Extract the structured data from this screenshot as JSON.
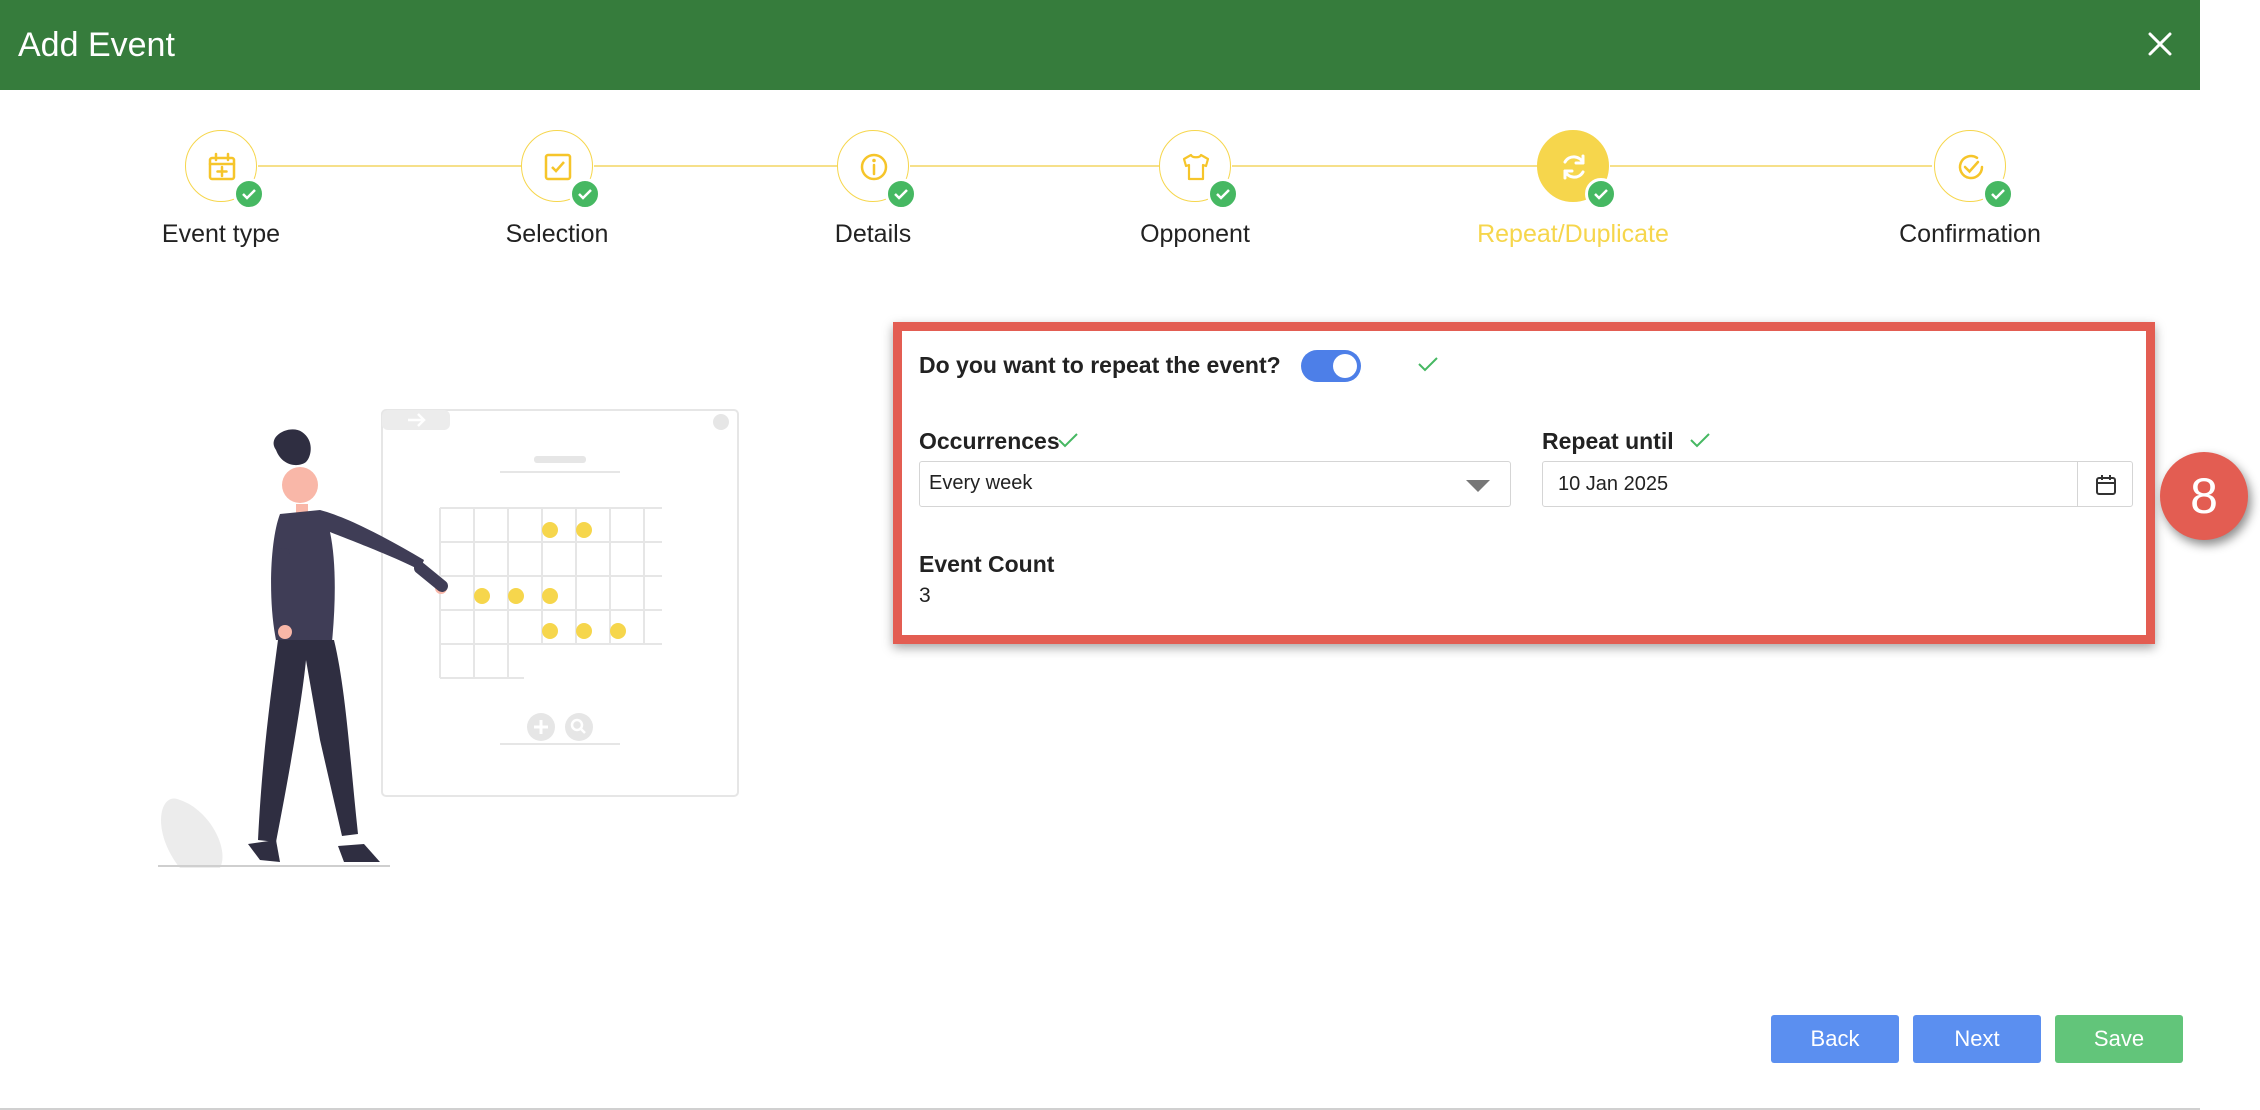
{
  "header": {
    "title": "Add Event",
    "close_icon": "close-icon"
  },
  "stepper": {
    "steps": [
      {
        "label": "Event type",
        "icon": "calendar-plus-icon",
        "done": true
      },
      {
        "label": "Selection",
        "icon": "checkbox-icon",
        "done": true
      },
      {
        "label": "Details",
        "icon": "info-icon",
        "done": true
      },
      {
        "label": "Opponent",
        "icon": "shirt-icon",
        "done": true
      },
      {
        "label": "Repeat/Duplicate",
        "icon": "refresh-icon",
        "done": true,
        "active": true
      },
      {
        "label": "Confirmation",
        "icon": "check-circle-icon",
        "done": true
      }
    ]
  },
  "form": {
    "repeat_question": "Do you want to repeat the event?",
    "repeat_enabled": true,
    "occurrences_label": "Occurrences",
    "occurrences_value": "Every week",
    "repeat_until_label": "Repeat until",
    "repeat_until_value": "10 Jan 2025",
    "event_count_label": "Event Count",
    "event_count_value": "3"
  },
  "annotation": {
    "marker": "8"
  },
  "footer": {
    "back_label": "Back",
    "next_label": "Next",
    "save_label": "Save"
  },
  "colors": {
    "header_bg": "#367c3c",
    "step_accent": "#f6d64c",
    "done_check": "#46b862",
    "highlight_border": "#e35d52",
    "primary_button": "#5b8ff0",
    "save_button": "#62c57a",
    "toggle_on": "#4d7fe8"
  }
}
